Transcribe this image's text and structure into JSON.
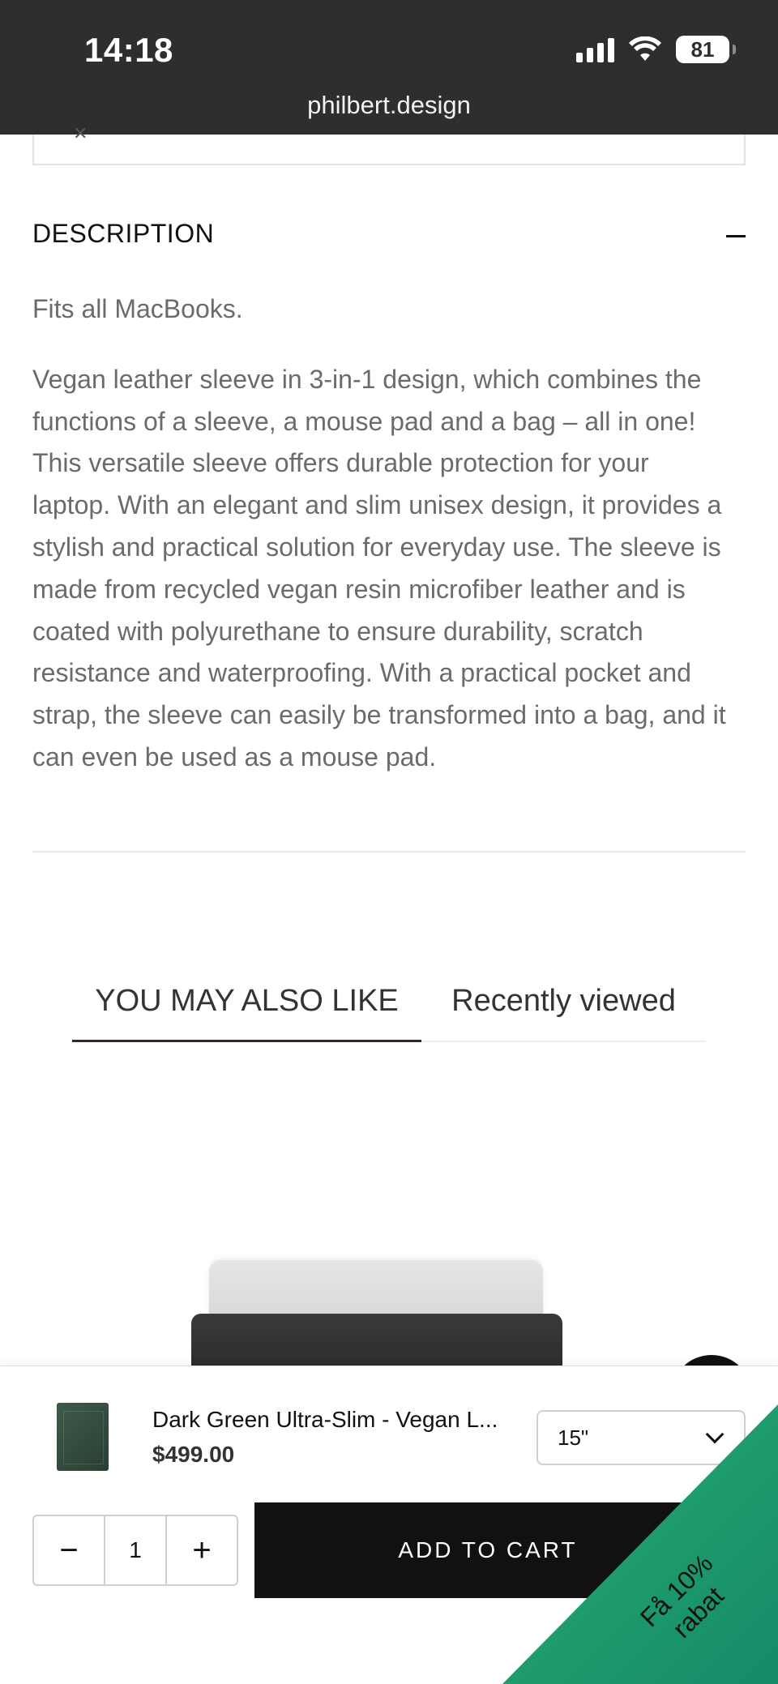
{
  "status_bar": {
    "time": "14:18",
    "battery": "81",
    "icons": [
      "cellular-signal-icon",
      "wifi-icon",
      "battery-icon"
    ]
  },
  "browser": {
    "url": "philbert.design"
  },
  "description": {
    "title": "DESCRIPTION",
    "toggle_icon": "minus-icon",
    "paragraph1": "Fits all MacBooks.",
    "paragraph2": "Vegan leather sleeve in 3-in-1 design, which combines the functions of a sleeve, a mouse pad and a bag – all in one! This versatile sleeve offers durable protection for your laptop. With an elegant and slim unisex design, it provides a stylish and practical solution for everyday use. The sleeve is made from recycled vegan resin microfiber leather and is coated with polyurethane to ensure durability, scratch resistance and waterproofing. With a practical pocket and strap, the sleeve can easily be transformed into a bag, and it can even be used as a mouse pad."
  },
  "tabs": [
    {
      "label": "YOU MAY ALSO LIKE",
      "active": true
    },
    {
      "label": "Recently viewed",
      "active": false
    }
  ],
  "sticky_cart": {
    "product_name": "Dark Green Ultra-Slim - Vegan L...",
    "price": "$499.00",
    "variant_selected": "15\"",
    "quantity": "1",
    "minus": "−",
    "plus": "+",
    "add_to_cart": "ADD TO CART"
  },
  "discount_badge": {
    "line1": "Få 10%",
    "line2": "rabat"
  },
  "colors": {
    "topbar": "#2c2e30",
    "accent_tab_underline": "#3a2323",
    "button": "#111111",
    "badge_green": "#1d9a6b"
  }
}
